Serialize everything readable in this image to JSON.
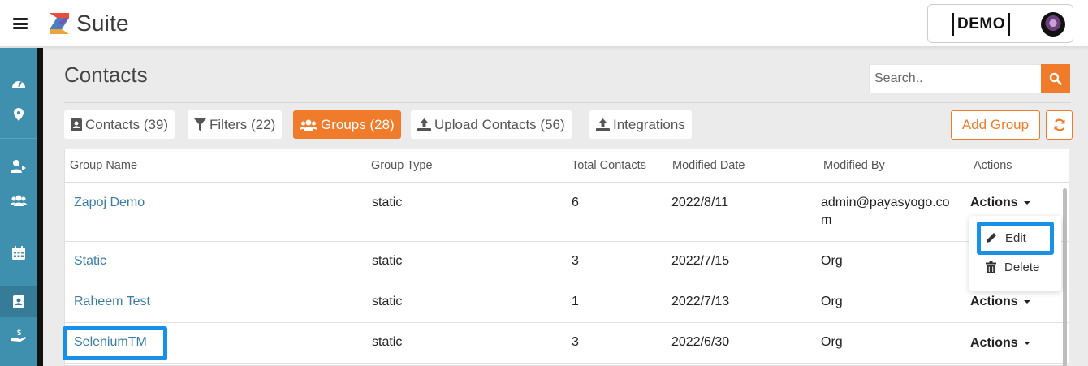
{
  "header": {
    "app_name": "Suite",
    "workspace_label": "DEMO"
  },
  "sidebar": {
    "items": [
      {
        "icon": "dashboard-icon"
      },
      {
        "icon": "location-pin-icon"
      },
      {
        "icon": "user-arrow-icon"
      },
      {
        "icon": "users-icon"
      },
      {
        "icon": "calendar-icon"
      },
      {
        "icon": "address-book-icon",
        "active": true
      },
      {
        "icon": "hand-dollar-icon"
      }
    ]
  },
  "page": {
    "title": "Contacts"
  },
  "search": {
    "placeholder": "Search.."
  },
  "tabs": [
    {
      "label": "Contacts (39)",
      "icon": "address-card-icon"
    },
    {
      "label": "Filters (22)",
      "icon": "filter-icon"
    },
    {
      "label": "Groups (28)",
      "icon": "users-icon",
      "active": true
    },
    {
      "label": "Upload Contacts (56)",
      "icon": "upload-icon"
    },
    {
      "label": "Integrations",
      "icon": "upload-icon"
    }
  ],
  "toolbar": {
    "add_group_label": "Add Group"
  },
  "table": {
    "columns": [
      "Group Name",
      "Group Type",
      "Total Contacts",
      "Modified Date",
      "Modified By",
      "Actions"
    ],
    "rows": [
      {
        "name": "Zapoj Demo",
        "type": "static",
        "total": "6",
        "date": "2022/8/11",
        "by": "admin@payasyogo.com",
        "actions": "Actions"
      },
      {
        "name": "Static",
        "type": "static",
        "total": "3",
        "date": "2022/7/15",
        "by": "Org",
        "actions": "Actions"
      },
      {
        "name": "Raheem Test",
        "type": "static",
        "total": "1",
        "date": "2022/7/13",
        "by": "Org",
        "actions": "Actions"
      },
      {
        "name": "SeleniumTM",
        "type": "static",
        "total": "3",
        "date": "2022/6/30",
        "by": "Org",
        "actions": "Actions"
      }
    ]
  },
  "actions_menu": {
    "edit_label": "Edit",
    "delete_label": "Delete"
  },
  "colors": {
    "accent": "#f07b2a",
    "sidebar": "#3f8fae",
    "link": "#3a7ea4",
    "highlight": "#1890e8"
  }
}
